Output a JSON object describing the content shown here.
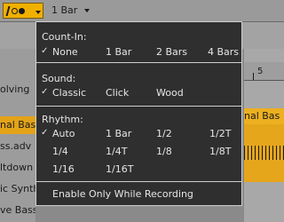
{
  "toolbar": {
    "quantization_label": "1 Bar"
  },
  "background": {
    "list_items": [
      "olving",
      "",
      "nal Bas",
      "ss.adv",
      "ltdown",
      "ic Synth",
      "ve Bass"
    ],
    "ruler_label": "5",
    "clip_label": "nal Bas",
    "accent_color": "#e3a319"
  },
  "menu": {
    "count_in": {
      "header": "Count-In:",
      "options": [
        "None",
        "1 Bar",
        "2 Bars",
        "4 Bars"
      ],
      "checked": "None"
    },
    "sound": {
      "header": "Sound:",
      "options": [
        "Classic",
        "Click",
        "Wood"
      ],
      "checked": "Classic"
    },
    "rhythm": {
      "header": "Rhythm:",
      "options": [
        "Auto",
        "1 Bar",
        "1/2",
        "1/2T",
        "1/4",
        "1/4T",
        "1/8",
        "1/8T",
        "1/16",
        "1/16T"
      ],
      "checked": "Auto"
    },
    "recording_option": "Enable Only While Recording",
    "check_glyph": "✓"
  }
}
